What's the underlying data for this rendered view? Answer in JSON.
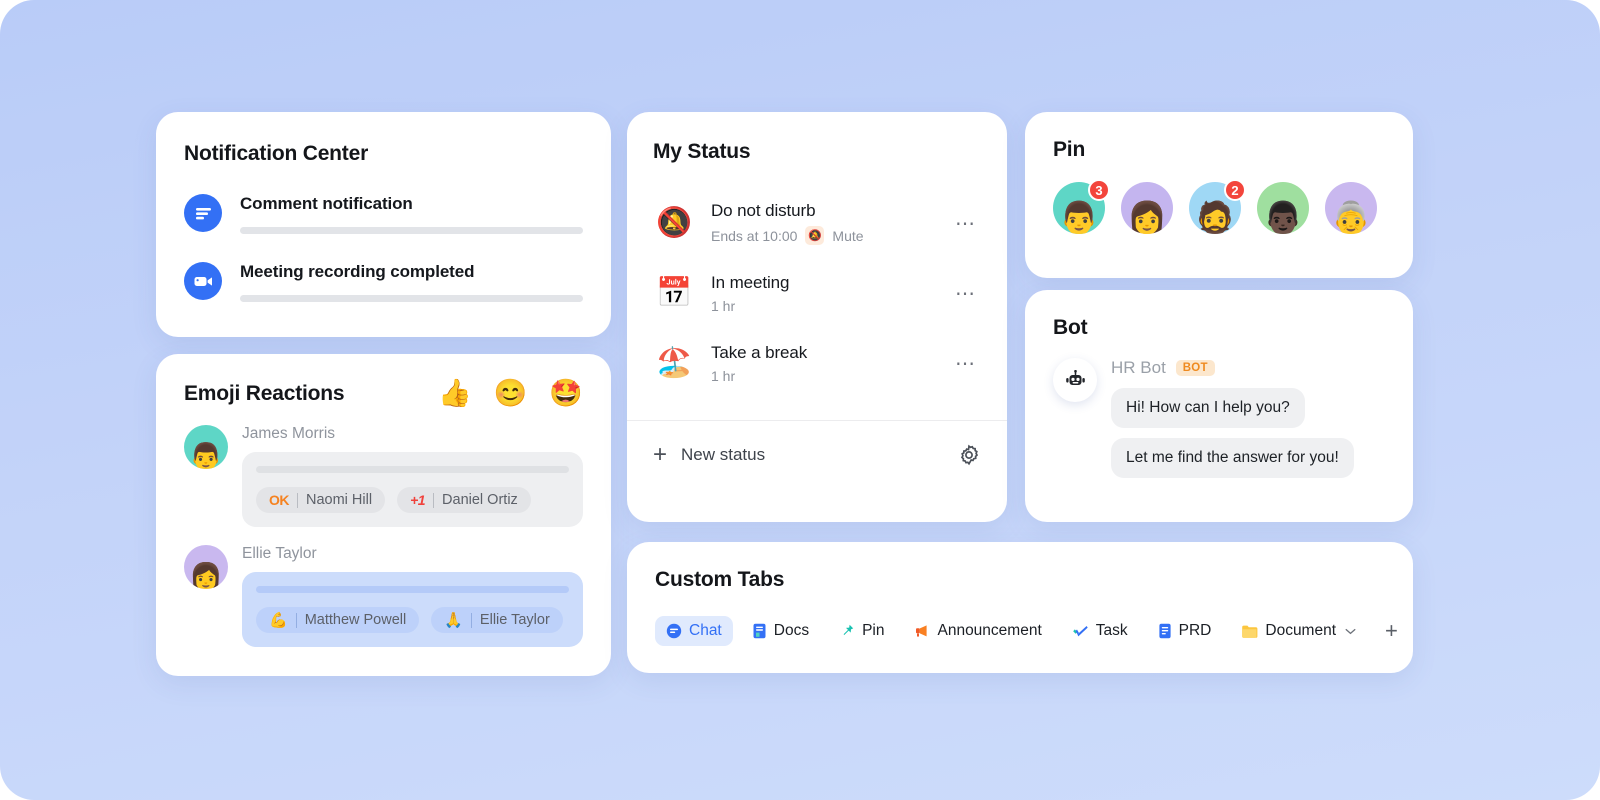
{
  "notification_center": {
    "title": "Notification Center",
    "items": [
      {
        "label": "Comment notification",
        "icon": "comment-lines-icon"
      },
      {
        "label": "Meeting recording completed",
        "icon": "video-camera-icon"
      }
    ]
  },
  "emoji_reactions": {
    "title": "Emoji Reactions",
    "header_emojis": [
      {
        "name": "thumbs-up-emoji",
        "glyph": "👍"
      },
      {
        "name": "done-face-emoji",
        "glyph": "😊"
      },
      {
        "name": "star-struck-emoji",
        "glyph": "🤩"
      }
    ],
    "reactions": [
      {
        "user": "James Morris",
        "avatar_glyph": "👨",
        "avatar_bg": "#5ed6c6",
        "theme": "grey",
        "pills": [
          {
            "emoji_name": "ok-emoji",
            "emoji_text": "OK",
            "user": "Naomi Hill"
          },
          {
            "emoji_name": "plus-one-emoji",
            "emoji_text": "+1",
            "user": "Daniel Ortiz"
          }
        ]
      },
      {
        "user": "Ellie Taylor",
        "avatar_glyph": "👩",
        "avatar_bg": "#c9b8ef",
        "theme": "blue",
        "pills": [
          {
            "emoji_name": "flexed-biceps-emoji",
            "emoji_text": "💪",
            "user": "Matthew Powell"
          },
          {
            "emoji_name": "folded-hands-emoji",
            "emoji_text": "🙏",
            "user": "Ellie Taylor"
          }
        ]
      }
    ]
  },
  "my_status": {
    "title": "My Status",
    "items": [
      {
        "emoji_name": "bell-slash-emoji",
        "emoji": "🔕",
        "name": "Do not disturb",
        "sub": "Ends at 10:00",
        "mute_label": "Mute",
        "mute_icon": "🔕",
        "has_mute": true,
        "more": "⋯"
      },
      {
        "emoji_name": "calendar-emoji",
        "emoji": "📅",
        "name": "In meeting",
        "sub": "1 hr",
        "has_mute": false,
        "more": "⋯"
      },
      {
        "emoji_name": "beach-umbrella-emoji",
        "emoji": "🏖️",
        "name": "Take a break",
        "sub": "1 hr",
        "has_mute": false,
        "more": "⋯"
      }
    ],
    "new_status_label": "New status",
    "settings_icon": "gear-icon",
    "plus_icon": "+"
  },
  "pin": {
    "title": "Pin",
    "avatars": [
      {
        "glyph": "👨",
        "bg": "#5ed6c6",
        "badge": "3"
      },
      {
        "glyph": "👩",
        "bg": "#c4b5ef",
        "badge": ""
      },
      {
        "glyph": "🧔",
        "bg": "#9fd8f5",
        "badge": "2"
      },
      {
        "glyph": "👨🏿",
        "bg": "#9fdf9f",
        "badge": ""
      },
      {
        "glyph": "👵",
        "bg": "#c9b8ef",
        "badge": ""
      }
    ]
  },
  "bot": {
    "title": "Bot",
    "avatar_icon": "robot-icon",
    "name": "HR Bot",
    "badge": "BOT",
    "messages": [
      "Hi! How can I help you?",
      "Let me find the answer for you!"
    ]
  },
  "custom_tabs": {
    "title": "Custom Tabs",
    "tabs": [
      {
        "label": "Chat",
        "icon_name": "chat-bubble-icon",
        "active": true,
        "chevron": false
      },
      {
        "label": "Docs",
        "icon_name": "docs-icon",
        "active": false,
        "chevron": false
      },
      {
        "label": "Pin",
        "icon_name": "pushpin-icon",
        "active": false,
        "chevron": false
      },
      {
        "label": "Announcement",
        "icon_name": "megaphone-icon",
        "active": false,
        "chevron": false
      },
      {
        "label": "Task",
        "icon_name": "check-task-icon",
        "active": false,
        "chevron": false
      },
      {
        "label": "PRD",
        "icon_name": "document-blue-icon",
        "active": false,
        "chevron": false
      },
      {
        "label": "Document",
        "icon_name": "folder-icon",
        "active": false,
        "chevron": true
      }
    ],
    "add_label": "+",
    "chevron_glyph": "⌄"
  },
  "colors": {
    "background": "#c3d3f9",
    "accent_blue": "#3370f5",
    "badge_red": "#f3453c",
    "bot_badge_orange": "#ef8a1f"
  }
}
